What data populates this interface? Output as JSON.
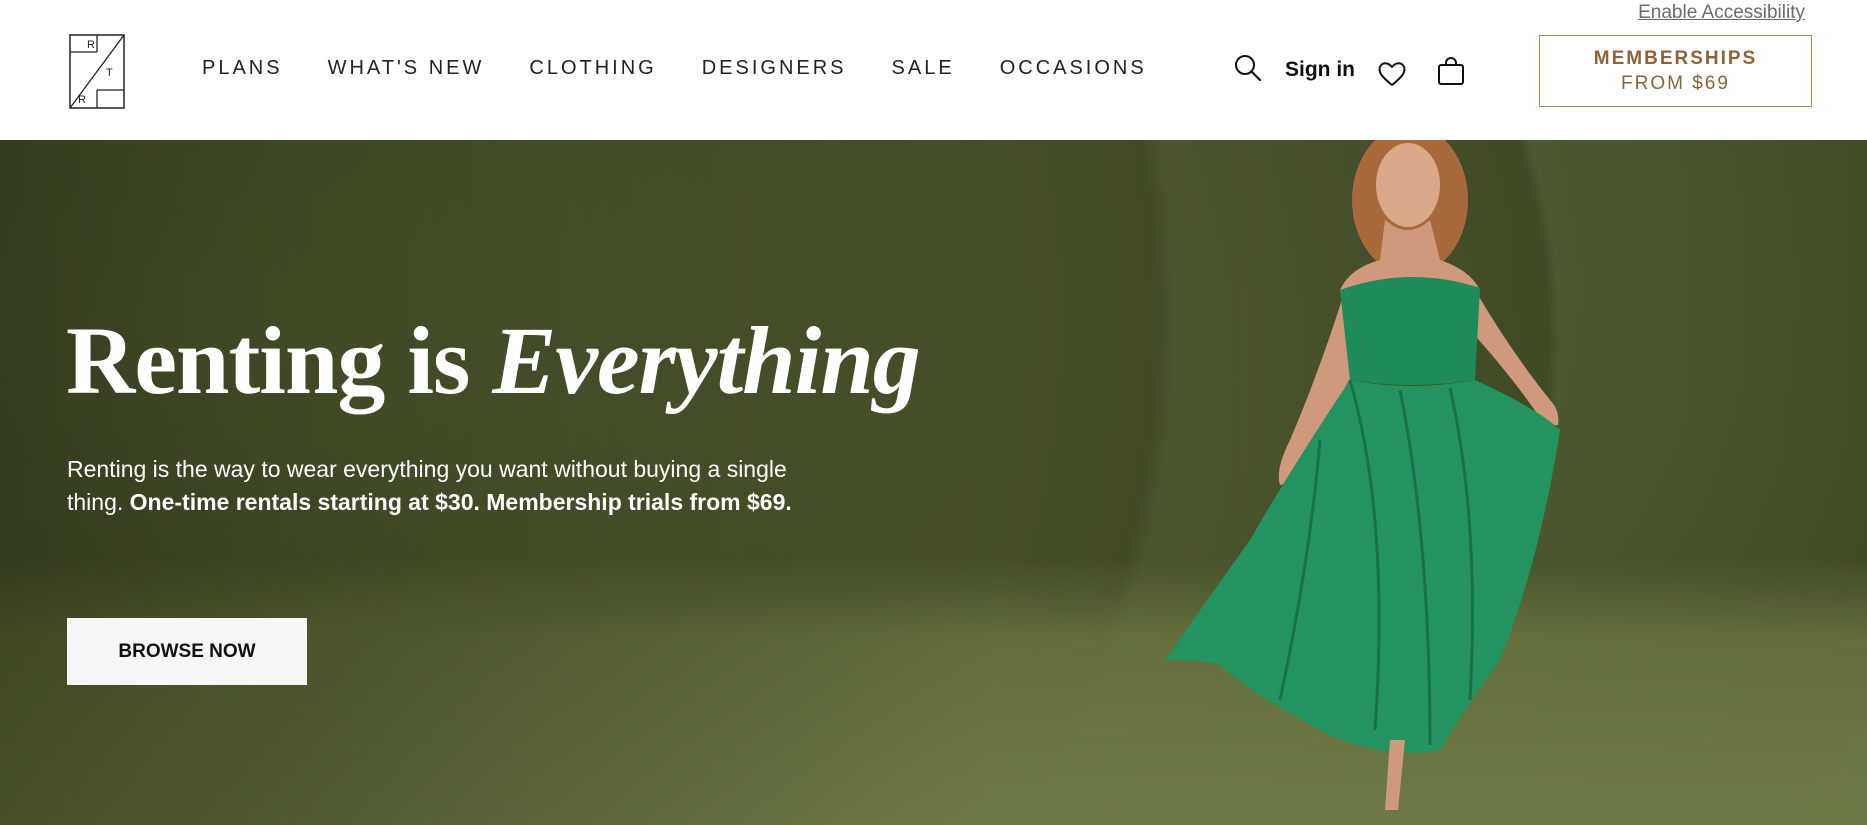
{
  "header": {
    "accessibility_link": "Enable Accessibility",
    "logo_letters": [
      "R",
      "T",
      "R"
    ],
    "nav": [
      "PLANS",
      "WHAT'S NEW",
      "CLOTHING",
      "DESIGNERS",
      "SALE",
      "OCCASIONS"
    ],
    "sign_in": "Sign in",
    "membership_line1": "MEMBERSHIPS",
    "membership_line2": "FROM $69",
    "icons": [
      "search-icon",
      "heart-icon",
      "shopping-bag-icon"
    ]
  },
  "hero": {
    "title_plain": "Renting is ",
    "title_italic": "Everything",
    "description_plain": "Renting is the way to wear everything you want without buying a single thing. ",
    "description_bold": "One-time rentals starting at $30. Membership trials from $69.",
    "cta_label": "BROWSE NOW"
  },
  "colors": {
    "accent": "#8c6238",
    "border_accent": "#b08658",
    "dress": "#1f8a5a",
    "hero_bg": "#4b5530"
  }
}
